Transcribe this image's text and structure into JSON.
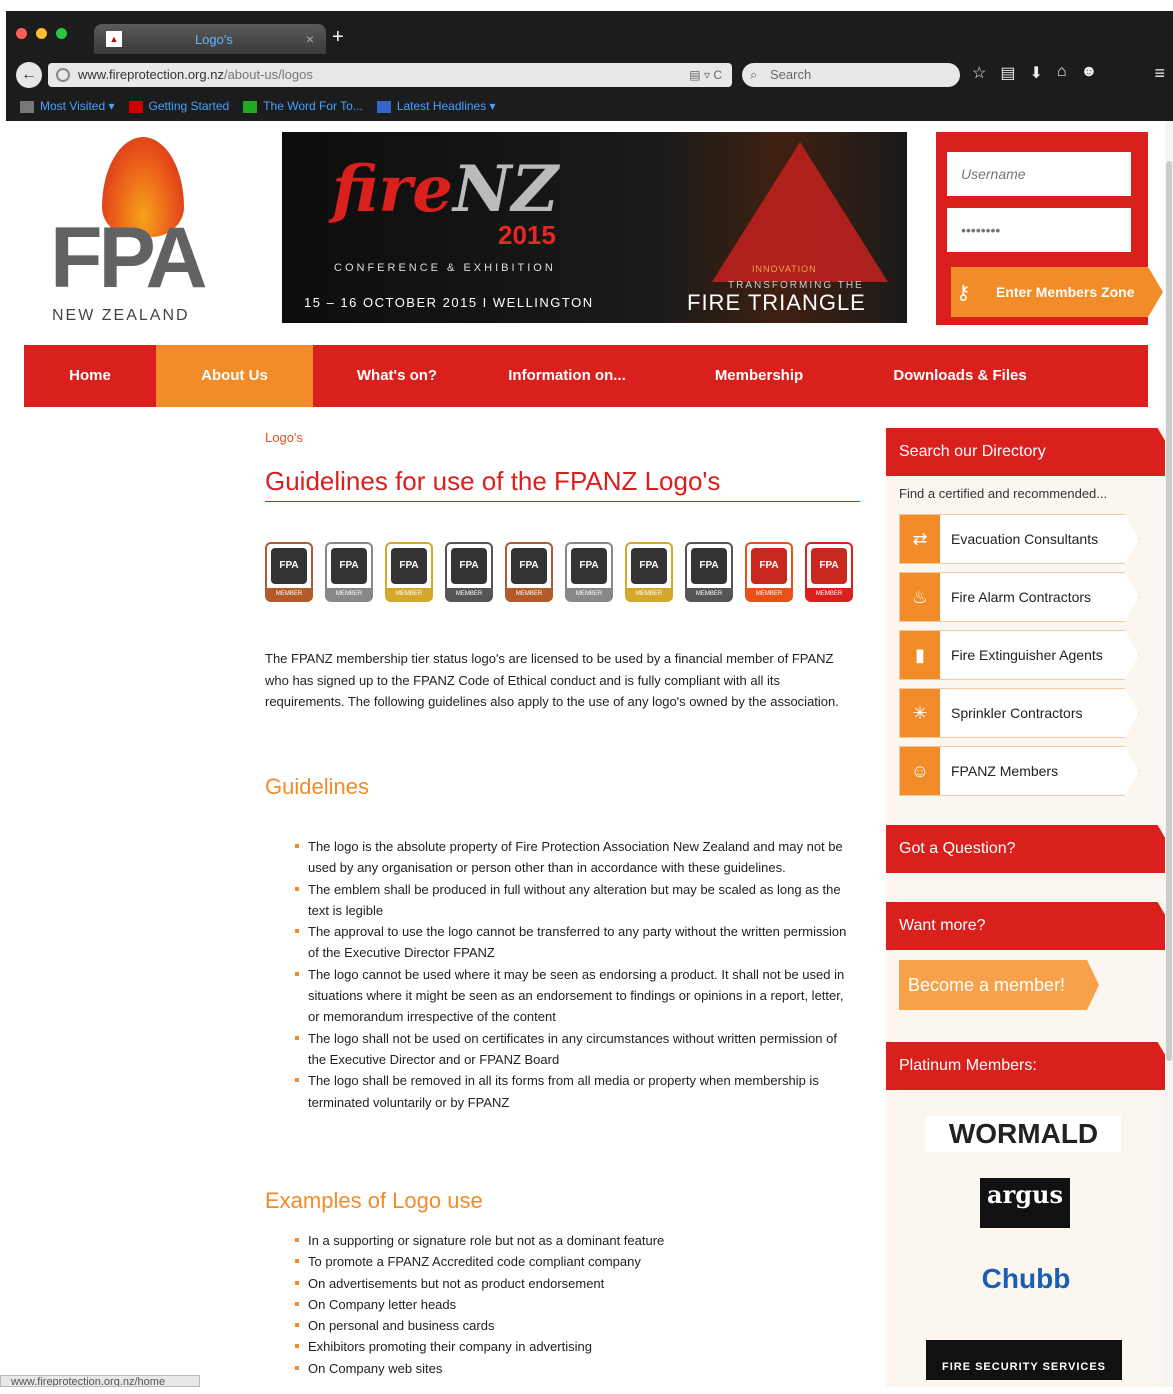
{
  "browser": {
    "tab_title": "Logo's",
    "url_domain": "www.fireprotection.org.nz",
    "url_path": "/about-us/logos",
    "search_placeholder": "Search",
    "bookmarks": [
      "Most Visited",
      "Getting Started",
      "The Word For To...",
      "Latest Headlines"
    ],
    "status_url": "www.fireprotection.org.nz/home"
  },
  "header": {
    "logo_main": "FPA",
    "logo_sub": "NEW ZEALAND",
    "banner": {
      "fire": "fire",
      "nz": "NZ",
      "year": "2015",
      "conference": "CONFERENCE & EXHIBITION",
      "date": "15 – 16 OCTOBER 2015 I WELLINGTON",
      "innovation": "INNOVATION",
      "transforming": "TRANSFORMING THE",
      "fire_triangle": "FIRE TRIANGLE"
    },
    "login": {
      "username_placeholder": "Username",
      "password_placeholder": "••••••••",
      "enter_label": "Enter Members Zone"
    }
  },
  "nav": [
    "Home",
    "About Us",
    "What's on?",
    "Information on...",
    "Membership",
    "Downloads & Files"
  ],
  "content": {
    "breadcrumb": "Logo's",
    "title": "Guidelines for use of the FPANZ Logo's",
    "badge_text": "FPA",
    "badge_labels": [
      "MEMBER",
      "MEMBER",
      "MEMBER",
      "MEMBER",
      "MEMBER",
      "MEMBER",
      "MEMBER",
      "MEMBER",
      "MEMBER",
      "MEMBER"
    ],
    "intro": "The FPANZ membership tier status logo's are licensed to be used by a financial member of FPANZ who has signed up to the FPANZ Code of Ethical conduct and is fully compliant with all its requirements. The following guidelines also apply to the use of any logo's owned by the association.",
    "guidelines_heading": "Guidelines",
    "guidelines": [
      "The logo is the absolute property of Fire Protection Association New Zealand and may not be used by any organisation or person other than in accordance with these guidelines.",
      "The emblem shall be produced in full without any alteration but may be scaled as long as the text is legible",
      "The approval to use the logo cannot be transferred to any party without the written permission of the Executive Director FPANZ",
      "The logo cannot be used where it may be seen as endorsing a product. It shall not be used in situations where it might be seen as an endorsement to findings or opinions in a report, letter, or memorandum irrespective of the content",
      "The logo shall not be used on certificates in any circumstances without written permission of the Executive Director and or FPANZ Board",
      "The logo shall be removed in all its forms from all media or property when membership is terminated voluntarily or by FPANZ"
    ],
    "examples_heading": "Examples of Logo use",
    "examples": [
      "In a supporting or signature role but not as a dominant feature",
      "To promote a FPANZ Accredited code compliant company",
      "On advertisements but not as product endorsement",
      "On Company letter heads",
      "On personal and business cards",
      "Exhibitors promoting their company in advertising",
      "On Company web sites"
    ]
  },
  "sidebar": {
    "search_heading": "Search our Directory",
    "find_text": "Find a certified and recommended...",
    "directory": [
      "Evacuation Consultants",
      "Fire Alarm Contractors",
      "Fire Extinguisher Agents",
      "Sprinkler Contractors",
      "FPANZ Members"
    ],
    "question_heading": "Got a Question?",
    "want_more_heading": "Want more?",
    "become_label": "Become a member!",
    "platinum_heading": "Platinum Members:",
    "sponsors": [
      "WORMALD",
      "argus",
      "Chubb",
      "FIRE SECURITY SERVICES"
    ]
  },
  "colors": {
    "brand_red": "#d9201d",
    "brand_orange": "#f28c28"
  }
}
